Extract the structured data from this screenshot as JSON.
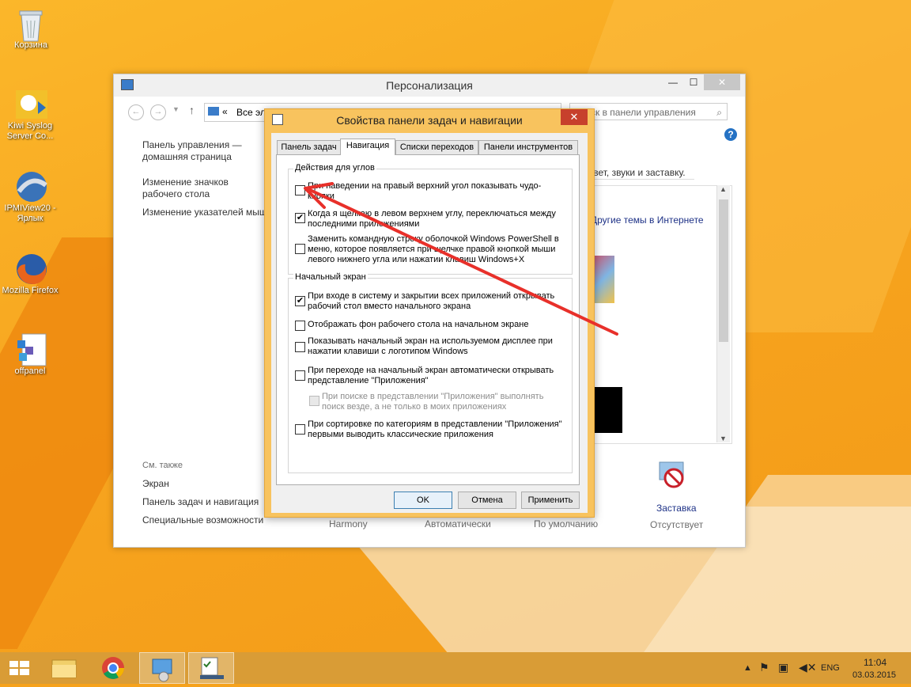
{
  "desktop": {
    "icons": [
      {
        "label": "Корзина"
      },
      {
        "label": "Kiwi Syslog Server Co..."
      },
      {
        "label": "IPMIView20 - Ярлык"
      },
      {
        "label": "Mozilla Firefox"
      },
      {
        "label": "offpanel"
      }
    ]
  },
  "personalization": {
    "title": "Персонализация",
    "address_chevron": "«",
    "address_text": "Все эл",
    "search_placeholder": "Поиск в панели управления",
    "sidebar": {
      "home": "Панель управления — домашняя страница",
      "link1": "Изменение значков рабочего стола",
      "link2": "Изменение указателей мыши",
      "see_also": "См. также",
      "see1": "Экран",
      "see2": "Панель задач и навигация",
      "see3": "Специальные возможности"
    },
    "header_text": "а, цвет, звуки и заставку.",
    "online_themes": "Другие темы в Интернете",
    "bottom": {
      "harmony": "Harmony",
      "auto": "Автоматически",
      "default": "По умолчанию",
      "screensaver": "Заставка",
      "screensaver_value": "Отсутствует"
    }
  },
  "dialog": {
    "title": "Свойства панели задач и навигации",
    "close_glyph": "✕",
    "tabs": [
      "Панель задач",
      "Навигация",
      "Списки переходов",
      "Панели инструментов"
    ],
    "active_tab": "Навигация",
    "corner_group": {
      "label": "Действия для углов",
      "options": [
        {
          "text": "При наведении на правый верхний угол показывать чудо-кнопки",
          "checked": false
        },
        {
          "text": "Когда я щелкаю в левом верхнем углу, переключаться между последними приложениями",
          "checked": true
        },
        {
          "text": "Заменить командную строку оболочкой Windows PowerShell в меню, которое появляется при щелчке правой кнопкой мыши левого нижнего угла или нажатии клавиш Windows+X",
          "checked": false
        }
      ]
    },
    "start_group": {
      "label": "Начальный экран",
      "options": [
        {
          "text": "При входе в систему и закрытии всех приложений открывать рабочий стол вместо начального экрана",
          "checked": true
        },
        {
          "text": "Отображать фон рабочего стола на начальном экране",
          "checked": false
        },
        {
          "text": "Показывать начальный экран на используемом дисплее при нажатии клавиши с логотипом Windows",
          "checked": false
        },
        {
          "text": "При переходе на начальный экран автоматически открывать представление \"Приложения\"",
          "checked": false
        },
        {
          "text": "При поиске в представлении \"Приложения\" выполнять поиск везде, а не только в моих приложениях",
          "checked": false,
          "disabled": true
        },
        {
          "text": "При сортировке по категориям в представлении \"Приложения\" первыми выводить классические приложения",
          "checked": false
        }
      ]
    },
    "buttons": {
      "ok": "OK",
      "cancel": "Отмена",
      "apply": "Применить"
    }
  },
  "taskbar": {
    "language": "ENG",
    "time": "11:04",
    "date": "03.03.2015"
  },
  "colors": {
    "desktop": "#f7a51f",
    "taskbar": "#d99c36",
    "dialog_frame": "#f8c35e",
    "close_red": "#c7402c",
    "annotation_arrow": "#e8302a"
  }
}
